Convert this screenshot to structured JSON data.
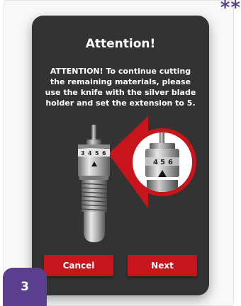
{
  "dialog": {
    "title": "Attention!",
    "message": "ATTENTION! To continue cutting the remaining materials, please use the knife with the silver blade holder and set the extension to 5.",
    "cancel_label": "Cancel",
    "next_label": "Next"
  },
  "knife_scale": {
    "numbers": [
      "3",
      "4",
      "5",
      "6"
    ]
  },
  "step_badge": "3",
  "corner_marks": "**",
  "colors": {
    "dialog_bg": "#333333",
    "accent_red": "#c8151b",
    "badge_purple": "#5a3f8f"
  }
}
